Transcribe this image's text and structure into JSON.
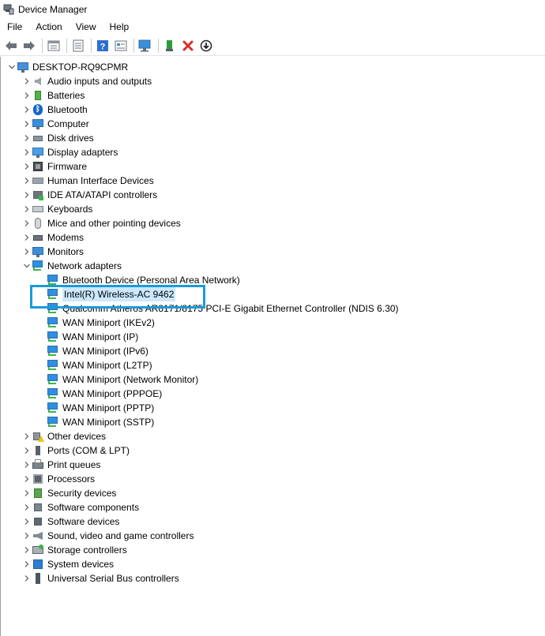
{
  "window": {
    "title": "Device Manager"
  },
  "menu": [
    "File",
    "Action",
    "View",
    "Help"
  ],
  "toolbar": {
    "icons": [
      "back-arrow-icon",
      "forward-arrow-icon",
      "properties-icon",
      "show-hide-icon",
      "help-icon",
      "view-icon",
      "scan-hardware-icon",
      "enable-device-icon",
      "uninstall-x-icon",
      "update-driver-icon"
    ],
    "colors": {
      "uninstall": "#d32f2f",
      "enable": "#2e9a3e"
    }
  },
  "tree": {
    "root": "DESKTOP-RQ9CPMR",
    "categories": [
      {
        "label": "Audio inputs and outputs",
        "icon": "speaker-icon"
      },
      {
        "label": "Batteries",
        "icon": "battery-icon"
      },
      {
        "label": "Bluetooth",
        "icon": "bluetooth-icon"
      },
      {
        "label": "Computer",
        "icon": "monitor-icon"
      },
      {
        "label": "Disk drives",
        "icon": "disk-drive-icon"
      },
      {
        "label": "Display adapters",
        "icon": "display-adapter-icon"
      },
      {
        "label": "Firmware",
        "icon": "firmware-chip-icon"
      },
      {
        "label": "Human Interface Devices",
        "icon": "hid-icon"
      },
      {
        "label": "IDE ATA/ATAPI controllers",
        "icon": "ide-controller-icon"
      },
      {
        "label": "Keyboards",
        "icon": "keyboard-icon"
      },
      {
        "label": "Mice and other pointing devices",
        "icon": "mouse-icon"
      },
      {
        "label": "Modems",
        "icon": "modem-icon"
      },
      {
        "label": "Monitors",
        "icon": "monitor-icon"
      },
      {
        "label": "Network adapters",
        "icon": "network-adapter-icon",
        "expanded": true
      }
    ],
    "network_children": [
      "Bluetooth Device (Personal Area Network)",
      "Intel(R) Wireless-AC 9462",
      "Qualcomm Atheros AR8171/8175 PCI-E Gigabit Ethernet Controller (NDIS 6.30)",
      "WAN Miniport (IKEv2)",
      "WAN Miniport (IP)",
      "WAN Miniport (IPv6)",
      "WAN Miniport (L2TP)",
      "WAN Miniport (Network Monitor)",
      "WAN Miniport (PPPOE)",
      "WAN Miniport (PPTP)",
      "WAN Miniport (SSTP)"
    ],
    "selected": "Intel(R) Wireless-AC 9462",
    "categories_after": [
      {
        "label": "Other devices",
        "icon": "other-devices-warning-icon"
      },
      {
        "label": "Ports (COM & LPT)",
        "icon": "port-icon"
      },
      {
        "label": "Print queues",
        "icon": "printer-icon"
      },
      {
        "label": "Processors",
        "icon": "processor-icon"
      },
      {
        "label": "Security devices",
        "icon": "security-device-icon"
      },
      {
        "label": "Software components",
        "icon": "software-component-icon"
      },
      {
        "label": "Software devices",
        "icon": "software-device-icon"
      },
      {
        "label": "Sound, video and game controllers",
        "icon": "sound-controller-icon"
      },
      {
        "label": "Storage controllers",
        "icon": "storage-controller-icon"
      },
      {
        "label": "System devices",
        "icon": "system-device-icon"
      },
      {
        "label": "Universal Serial Bus controllers",
        "icon": "usb-icon"
      }
    ],
    "colors": {
      "selection_bg": "#cce8ff",
      "highlight_box": "#1a9bd7"
    }
  }
}
